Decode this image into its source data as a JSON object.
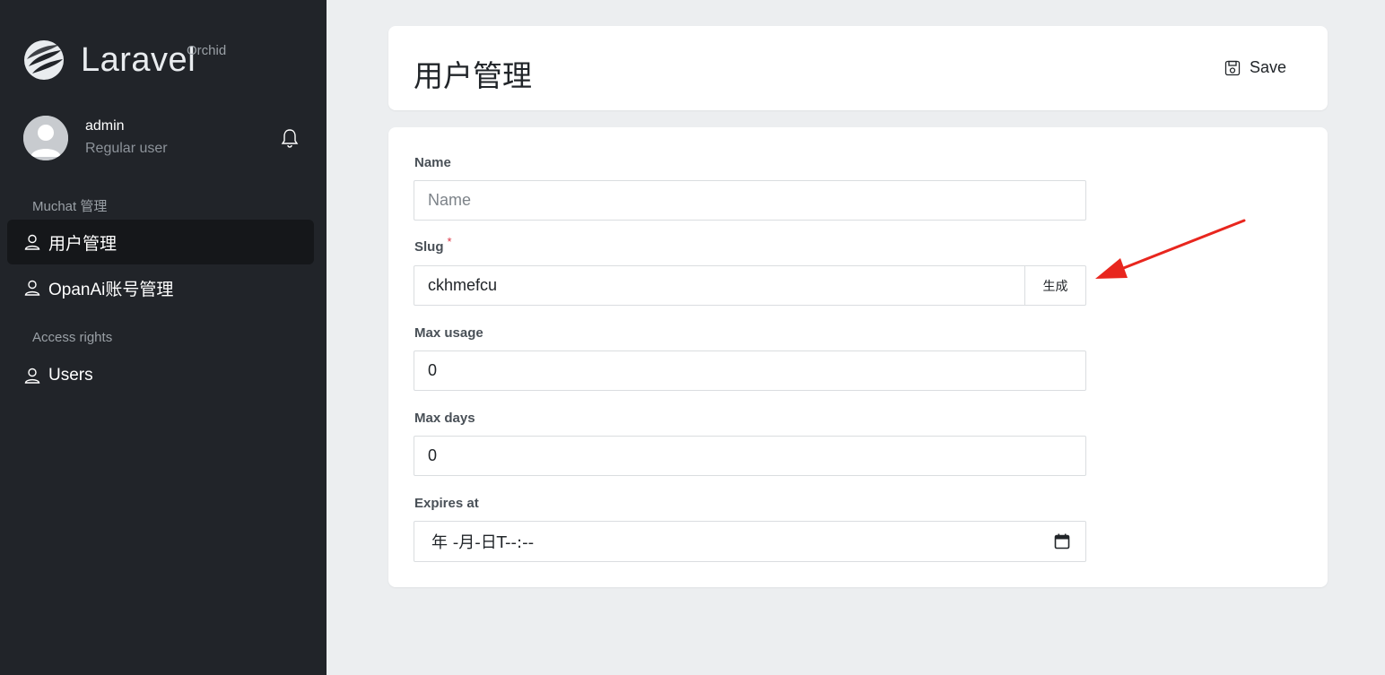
{
  "brand": {
    "name": "Laravel",
    "sub": "Orchid"
  },
  "profile": {
    "name": "admin",
    "role": "Regular user"
  },
  "nav": {
    "section1": "Muchat 管理",
    "item1": "用户管理",
    "item2": "OpanAi账号管理",
    "section2": "Access rights",
    "item3": "Users"
  },
  "header": {
    "title": "用户管理",
    "save_label": "Save"
  },
  "form": {
    "name_label": "Name",
    "name_placeholder": "Name",
    "slug_label": "Slug",
    "slug_required": "*",
    "slug_value": "ckhmefcu",
    "generate_label": "生成",
    "max_usage_label": "Max usage",
    "max_usage_value": "0",
    "max_days_label": "Max days",
    "max_days_value": "0",
    "expires_label": "Expires at",
    "expires_value": "年 -月-日T--:--"
  },
  "colors": {
    "sidebar": "#212429",
    "annotation": "#e8261e",
    "required": "#dc3545"
  }
}
